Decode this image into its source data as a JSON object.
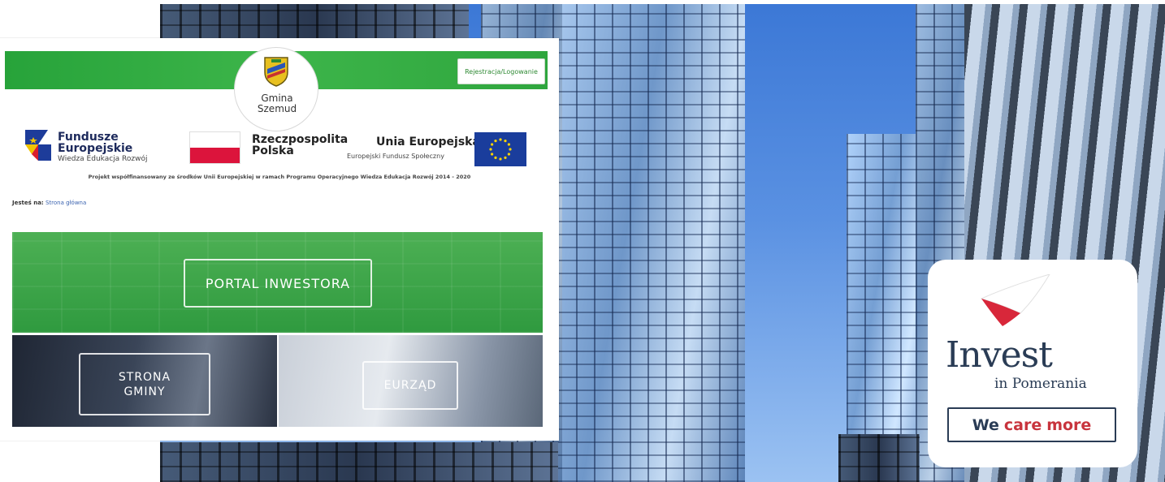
{
  "header": {
    "register_button": "Rejestracja/Logowanie",
    "municipality_name": "Gmina\nSzemud"
  },
  "funding": {
    "fe_title": "Fundusze\nEuropejskie",
    "fe_subtitle": "Wiedza Edukacja Rozwój",
    "rp_title": "Rzeczpospolita\nPolska",
    "ue_title": "Unia Europejska",
    "ue_subtitle": "Europejski Fundusz Społeczny",
    "project_note": "Projekt współfinansowany ze środków Unii Europejskiej w ramach Programu Operacyjnego Wiedza Edukacja Rozwój 2014 - 2020"
  },
  "breadcrumb": {
    "label": "Jesteś na:",
    "current": "Strona główna"
  },
  "tiles": {
    "portal": "PORTAL INWESTORA",
    "gminy": "STRONA\nGMINY",
    "eurzad": "EURZĄD"
  },
  "badge": {
    "invest": "Invest",
    "pomerania": "in Pomerania",
    "care_we": "We",
    "care_care": "care",
    "care_more": "more"
  },
  "colors": {
    "brand_green": "#3db54a",
    "badge_navy": "#2a3c55",
    "badge_red": "#c8343d",
    "flag_red": "#dc143c",
    "eu_blue": "#1a3d9c"
  }
}
